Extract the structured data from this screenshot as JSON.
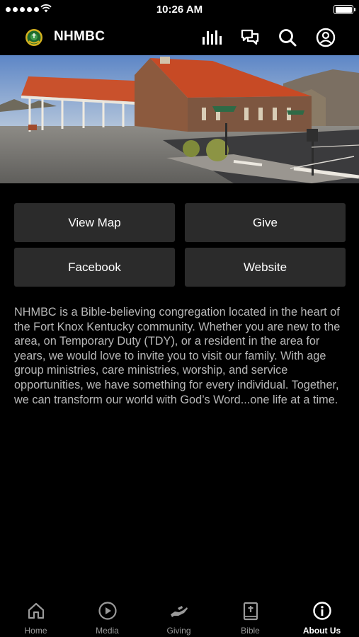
{
  "status_bar": {
    "time": "10:26 AM"
  },
  "header": {
    "title": "NHMBC"
  },
  "actions": {
    "view_map": "View Map",
    "give": "Give",
    "facebook": "Facebook",
    "website": "Website"
  },
  "about": {
    "description": "NHMBC is a Bible-believing congregation located in the heart of the Fort Knox Kentucky community. Whether you are new to the area, on Temporary Duty (TDY), or a resident in the area for years, we would love to invite you to visit our family. With age group ministries, care ministries, worship, and service opportunities, we have something for every individual. Together, we can transform our world with God’s Word...one life at a time."
  },
  "tabs": [
    {
      "label": "Home",
      "icon": "home-icon",
      "active": false
    },
    {
      "label": "Media",
      "icon": "play-icon",
      "active": false
    },
    {
      "label": "Giving",
      "icon": "giving-hand-icon",
      "active": false
    },
    {
      "label": "Bible",
      "icon": "bible-icon",
      "active": false
    },
    {
      "label": "About Us",
      "icon": "info-icon",
      "active": true
    }
  ],
  "colors": {
    "background": "#000000",
    "button": "#2b2b2b",
    "text_muted": "#b8b8b8",
    "tab_inactive": "#9a9a9a"
  }
}
